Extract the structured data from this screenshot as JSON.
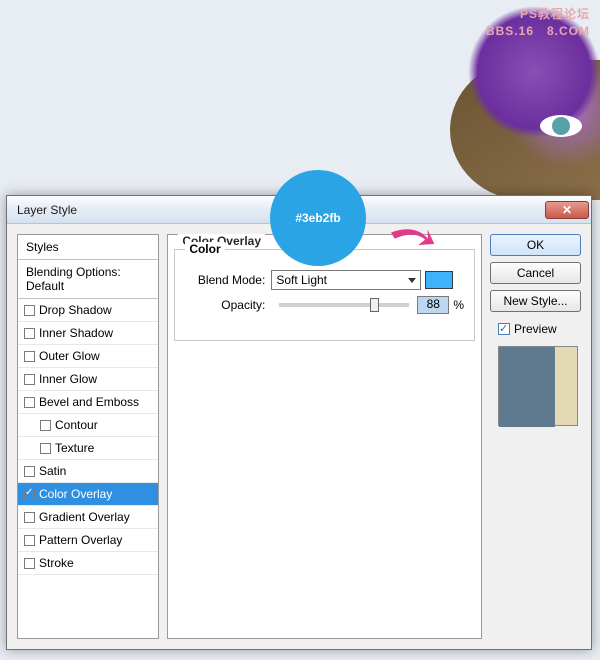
{
  "watermark": {
    "l1": "PS教程论坛",
    "l2": "BBS.16   8.COM"
  },
  "dialog": {
    "title": "Layer Style"
  },
  "styles_header": "Styles",
  "blending_header": "Blending Options: Default",
  "effects": [
    {
      "label": "Drop Shadow",
      "sel": false,
      "ck": false
    },
    {
      "label": "Inner Shadow",
      "sel": false,
      "ck": false
    },
    {
      "label": "Outer Glow",
      "sel": false,
      "ck": false
    },
    {
      "label": "Inner Glow",
      "sel": false,
      "ck": false
    },
    {
      "label": "Bevel and Emboss",
      "sel": false,
      "ck": false
    },
    {
      "label": "Contour",
      "sel": false,
      "ck": false,
      "indent": true
    },
    {
      "label": "Texture",
      "sel": false,
      "ck": false,
      "indent": true
    },
    {
      "label": "Satin",
      "sel": false,
      "ck": false
    },
    {
      "label": "Color Overlay",
      "sel": true,
      "ck": true
    },
    {
      "label": "Gradient Overlay",
      "sel": false,
      "ck": false
    },
    {
      "label": "Pattern Overlay",
      "sel": false,
      "ck": false
    },
    {
      "label": "Stroke",
      "sel": false,
      "ck": false
    }
  ],
  "panel": {
    "title": "Color Overlay",
    "group": "Color",
    "blend_label": "Blend Mode:",
    "blend_value": "Soft Light",
    "opacity_label": "Opacity:",
    "opacity_value": "88",
    "opacity_unit": "%",
    "swatch": "#3eb2fb"
  },
  "buttons": {
    "ok": "OK",
    "cancel": "Cancel",
    "newstyle": "New Style...",
    "preview": "Preview"
  },
  "callout": "#3eb2fb"
}
